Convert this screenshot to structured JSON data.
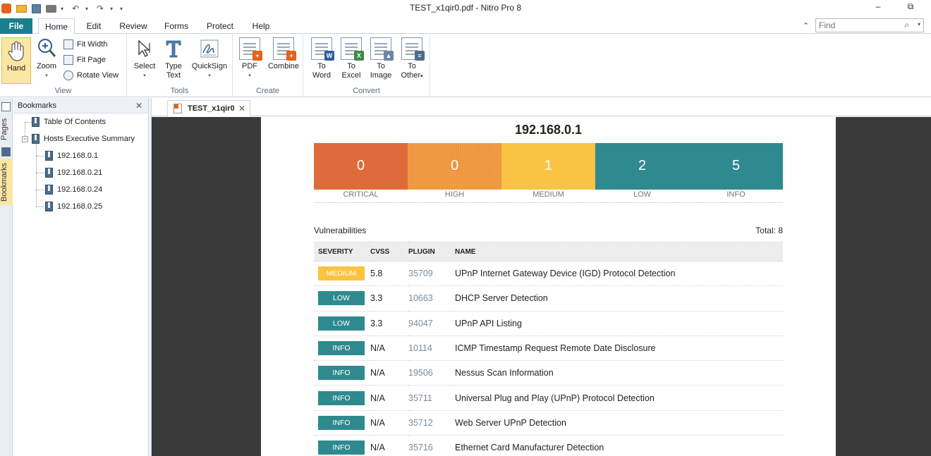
{
  "window": {
    "title": "TEST_x1qir0.pdf - Nitro Pro 8",
    "minimize": "–",
    "restore": "⧉"
  },
  "menu": {
    "file": "File",
    "tabs": [
      "Home",
      "Edit",
      "Review",
      "Forms",
      "Protect",
      "Help"
    ],
    "active_tab": "Home"
  },
  "find": {
    "placeholder": "Find"
  },
  "ribbon": {
    "view": {
      "label": "View",
      "hand": "Hand",
      "zoom": "Zoom",
      "fit_width": "Fit Width",
      "fit_page": "Fit Page",
      "rotate_view": "Rotate View"
    },
    "tools": {
      "label": "Tools",
      "select": "Select",
      "type_text_1": "Type",
      "type_text_2": "Text",
      "quicksign": "QuickSign"
    },
    "create": {
      "label": "Create",
      "pdf": "PDF",
      "combine": "Combine"
    },
    "convert": {
      "label": "Convert",
      "to_word": [
        "To",
        "Word"
      ],
      "to_excel": [
        "To",
        "Excel"
      ],
      "to_image": [
        "To",
        "Image"
      ],
      "to_other": [
        "To",
        "Other"
      ]
    }
  },
  "sidebar": {
    "tabs": [
      "Pages",
      "Bookmarks"
    ],
    "panel_title": "Bookmarks",
    "bookmarks": [
      "Table Of Contents",
      "Hosts Executive Summary",
      "192.168.0.1",
      "192.168.0.21",
      "192.168.0.24",
      "192.168.0.25"
    ]
  },
  "document": {
    "tab_label": "TEST_x1qir0",
    "host": "192.168.0.1",
    "severity": [
      {
        "label": "CRITICAL",
        "count": "0",
        "color": "#e06b3a"
      },
      {
        "label": "HIGH",
        "count": "0",
        "color": "#ee9336"
      },
      {
        "label": "MEDIUM",
        "count": "1",
        "color": "#fbc343"
      },
      {
        "label": "LOW",
        "count": "2",
        "color": "#2f8a8f"
      },
      {
        "label": "INFO",
        "count": "5",
        "color": "#2f8a8f"
      }
    ],
    "vulnerabilities_title": "Vulnerabilities",
    "total": "Total: 8",
    "columns": [
      "SEVERITY",
      "CVSS",
      "PLUGIN",
      "NAME"
    ],
    "rows": [
      {
        "severity": "MEDIUM",
        "color": "#fbc343",
        "cvss": "5.8",
        "plugin": "35709",
        "name": "UPnP Internet Gateway Device (IGD) Protocol Detection"
      },
      {
        "severity": "LOW",
        "color": "#2f8a8f",
        "cvss": "3.3",
        "plugin": "10663",
        "name": "DHCP Server Detection"
      },
      {
        "severity": "LOW",
        "color": "#2f8a8f",
        "cvss": "3.3",
        "plugin": "94047",
        "name": "UPnP API Listing"
      },
      {
        "severity": "INFO",
        "color": "#2f8a8f",
        "cvss": "N/A",
        "plugin": "10114",
        "name": "ICMP Timestamp Request Remote Date Disclosure"
      },
      {
        "severity": "INFO",
        "color": "#2f8a8f",
        "cvss": "N/A",
        "plugin": "19506",
        "name": "Nessus Scan Information"
      },
      {
        "severity": "INFO",
        "color": "#2f8a8f",
        "cvss": "N/A",
        "plugin": "35711",
        "name": "Universal Plug and Play (UPnP) Protocol Detection"
      },
      {
        "severity": "INFO",
        "color": "#2f8a8f",
        "cvss": "N/A",
        "plugin": "35712",
        "name": "Web Server UPnP Detection"
      },
      {
        "severity": "INFO",
        "color": "#2f8a8f",
        "cvss": "N/A",
        "plugin": "35716",
        "name": "Ethernet Card Manufacturer Detection"
      }
    ]
  }
}
